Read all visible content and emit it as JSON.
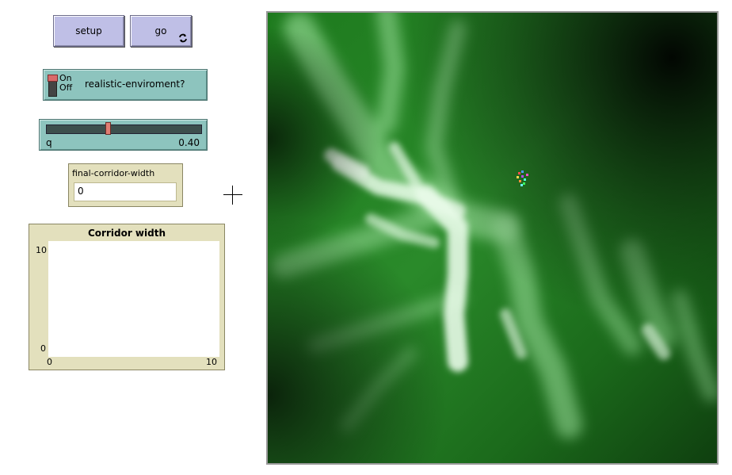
{
  "buttons": {
    "setup": "setup",
    "go": "go"
  },
  "switch": {
    "on_label": "On",
    "off_label": "Off",
    "label": "realistic-enviroment?"
  },
  "slider": {
    "name": "q",
    "value_text": "0.40",
    "value": 0.4
  },
  "monitor": {
    "label": "final-corridor-width",
    "value": "0"
  },
  "plot": {
    "title": "Corridor width",
    "y_max": "10",
    "y_min": "0",
    "x_min": "0",
    "x_max": "10"
  },
  "icons": {
    "go_forever": "forever-icon",
    "cursor": "crosshair-icon"
  },
  "colors": {
    "button": "#bfbfe6",
    "widget": "#8dc4be",
    "monitor": "#e3e0bd",
    "terrain_dark": "#0b1f0b",
    "terrain_light": "#f2fbf2"
  }
}
